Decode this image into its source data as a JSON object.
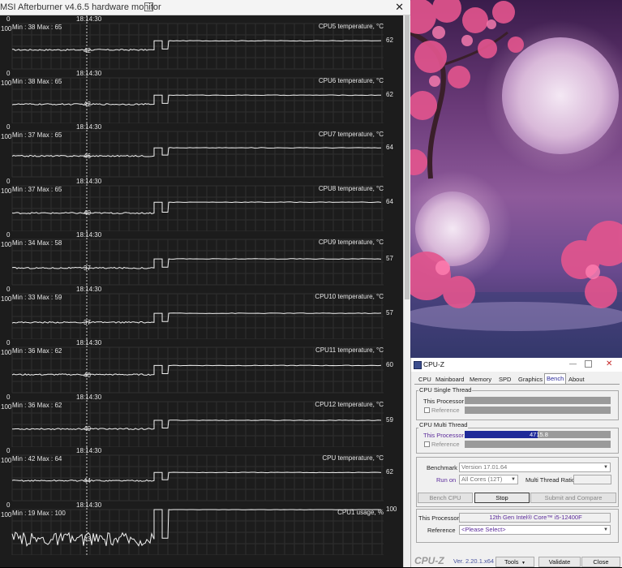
{
  "afterburner": {
    "title": "MSI Afterburner v4.6.5 hardware monitor",
    "close_glyph": "✕",
    "panels": [
      {
        "name": "CPU5 temperature, °C",
        "min_max": "Min : 38   Max : 65",
        "current": "62",
        "low_label": "42",
        "lo": 42,
        "hi": 62,
        "scale_max": "100",
        "scale_min": "0",
        "time": "18:14:30"
      },
      {
        "name": "CPU6 temperature, °C",
        "min_max": "Min : 38   Max : 65",
        "current": "62",
        "low_label": "42",
        "lo": 42,
        "hi": 62,
        "scale_max": "100",
        "scale_min": "0",
        "time": "18:14:30"
      },
      {
        "name": "CPU7 temperature, °C",
        "min_max": "Min : 37   Max : 65",
        "current": "64",
        "low_label": "46",
        "lo": 46,
        "hi": 64,
        "scale_max": "100",
        "scale_min": "0",
        "time": "18:14:30"
      },
      {
        "name": "CPU8 temperature, °C",
        "min_max": "Min : 37   Max : 65",
        "current": "64",
        "low_label": "40",
        "lo": 40,
        "hi": 64,
        "scale_max": "100",
        "scale_min": "0",
        "time": "18:14:30"
      },
      {
        "name": "CPU9 temperature, °C",
        "min_max": "Min : 34   Max : 58",
        "current": "57",
        "low_label": "37",
        "lo": 37,
        "hi": 57,
        "scale_max": "100",
        "scale_min": "0",
        "time": "18:14:30"
      },
      {
        "name": "CPU10 temperature, °C",
        "min_max": "Min : 33   Max : 59",
        "current": "57",
        "low_label": "37",
        "lo": 37,
        "hi": 57,
        "scale_max": "100",
        "scale_min": "0",
        "time": "18:14:30"
      },
      {
        "name": "CPU11 temperature, °C",
        "min_max": "Min : 36   Max : 62",
        "current": "60",
        "low_label": "40",
        "lo": 40,
        "hi": 60,
        "scale_max": "100",
        "scale_min": "0",
        "time": "18:14:30"
      },
      {
        "name": "CPU12 temperature, °C",
        "min_max": "Min : 36   Max : 62",
        "current": "59",
        "low_label": "40",
        "lo": 40,
        "hi": 59,
        "scale_max": "100",
        "scale_min": "0",
        "time": "18:14:30"
      },
      {
        "name": "CPU temperature, °C",
        "min_max": "Min : 42   Max : 64",
        "current": "62",
        "low_label": "44",
        "lo": 44,
        "hi": 62,
        "scale_max": "100",
        "scale_min": "0",
        "time": "18:14:30"
      },
      {
        "name": "CPU1 usage, %",
        "min_max": "Min : 19   Max : 100",
        "current": "100",
        "low_label": "43",
        "lo": 35,
        "hi": 100,
        "scale_max": "100",
        "scale_min": "0",
        "time": "18:14:30"
      }
    ]
  },
  "cpuz": {
    "title": "CPU-Z",
    "tabs": [
      "CPU",
      "Mainboard",
      "Memory",
      "SPD",
      "Graphics",
      "Bench",
      "About"
    ],
    "active_tab": "Bench",
    "single_thread": {
      "legend": "CPU Single Thread",
      "this_processor": "This Processor",
      "reference": "Reference",
      "progress": 0
    },
    "multi_thread": {
      "legend": "CPU Multi Thread",
      "this_processor": "This Processor",
      "score": "4715.8",
      "reference": "Reference",
      "progress": 0.5
    },
    "benchmark_label": "Benchmark",
    "benchmark_value": "Version 17.01.64",
    "run_on_label": "Run on",
    "run_on_value": "All Cores (12T)",
    "mt_ratio_label": "Multi Thread Ratio",
    "bench_cpu_button": "Bench CPU",
    "stop_button": "Stop",
    "submit_button": "Submit and Compare",
    "this_processor_label": "This Processor",
    "this_processor_value": "12th Gen Intel® Core™ i5-12400F",
    "reference_label": "Reference",
    "reference_value": "<Please Select>",
    "logo": "CPU-Z",
    "version": "Ver. 2.20.1.x64",
    "tools_button": "Tools",
    "validate_button": "Validate",
    "close_button": "Close",
    "colors": {
      "bar_fill": "#1f2a99",
      "bar_empty": "#9a9a9a",
      "accent_text": "#5b2b9b"
    }
  }
}
